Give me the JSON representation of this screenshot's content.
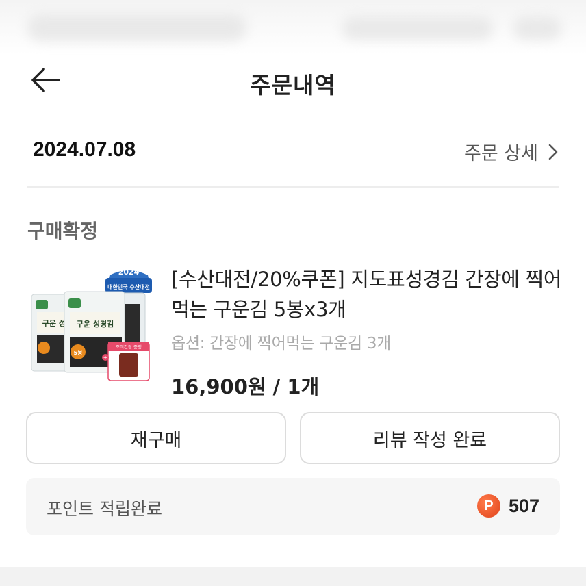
{
  "header": {
    "title": "주문내역"
  },
  "order": {
    "date": "2024.07.08",
    "detail_link": "주문 상세",
    "status": "구매확정"
  },
  "product": {
    "name": "[수산대전/20%쿠폰] 지도표성경김 간장에 찍어먹는 구운김 5봉x3개",
    "option": "옵션: 간장에 찍어먹는 구운김 3개",
    "price": "16,900원 / 1개",
    "thumb_badge_year": "2024",
    "thumb_badge_text": "대한민국 수산대전",
    "thumb_pack_brand": "구운 성경김",
    "thumb_pack_count": "5봉",
    "thumb_gift_label": "조미간장 증정"
  },
  "actions": {
    "rebuy": "재구매",
    "review": "리뷰 작성 완료"
  },
  "points": {
    "label": "포인트 적립완료",
    "icon_letter": "P",
    "value": "507"
  },
  "colors": {
    "point_icon": "#e64a1f",
    "divider": "#ededed",
    "muted_text": "#aaaaaa"
  },
  "icons": {
    "back": "arrow-left-icon",
    "detail": "chevron-right-icon",
    "points": "point-coin-icon"
  }
}
